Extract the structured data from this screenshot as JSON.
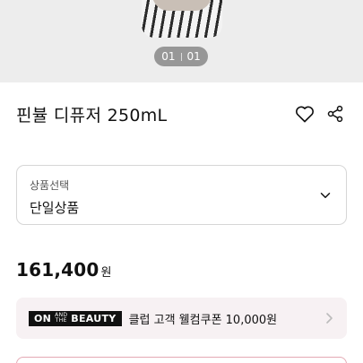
{
  "gallery": {
    "current": "01",
    "total": "01"
  },
  "product": {
    "name": "핀뷸 디퓨저 250mL",
    "price_value": "161,400",
    "price_unit": "원"
  },
  "option_select": {
    "caption": "상품선택",
    "value": "단일상품"
  },
  "promo": {
    "badge_on": "ON",
    "badge_small_1": "AND",
    "badge_small_2": "THE",
    "badge_beauty": "BEAUTY",
    "text": "클럽 고객 웰컴쿠폰 10,000원"
  },
  "icons": {
    "wishlist": "heart-icon",
    "share": "share-icon",
    "dropdown": "chevron-down-icon",
    "promo_link": "chevron-right-icon"
  },
  "colors": {
    "promo_bg": "#f7f1f3",
    "bottom_button_border": "#e4a9b4"
  }
}
